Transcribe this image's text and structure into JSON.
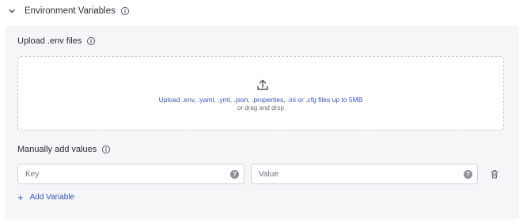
{
  "header": {
    "title": "Environment Variables"
  },
  "upload": {
    "label": "Upload .env files",
    "primary_text": "Upload .env, .yaml, .yml, .json, .properties, .ini or .cfg files up to 5MB",
    "secondary_text": "or drag and drop"
  },
  "manual": {
    "label": "Manually add values",
    "key_placeholder": "Key",
    "value_placeholder": "Value",
    "help_glyph": "?",
    "add_label": "Add Variable",
    "add_glyph": "+"
  },
  "colors": {
    "accent": "#3957b8",
    "panel_bg": "#f5f6f8",
    "border": "#cfd2d9"
  },
  "icons": [
    "chevron-down-icon",
    "info-icon",
    "upload-icon",
    "help-icon",
    "trash-icon",
    "plus-icon"
  ]
}
